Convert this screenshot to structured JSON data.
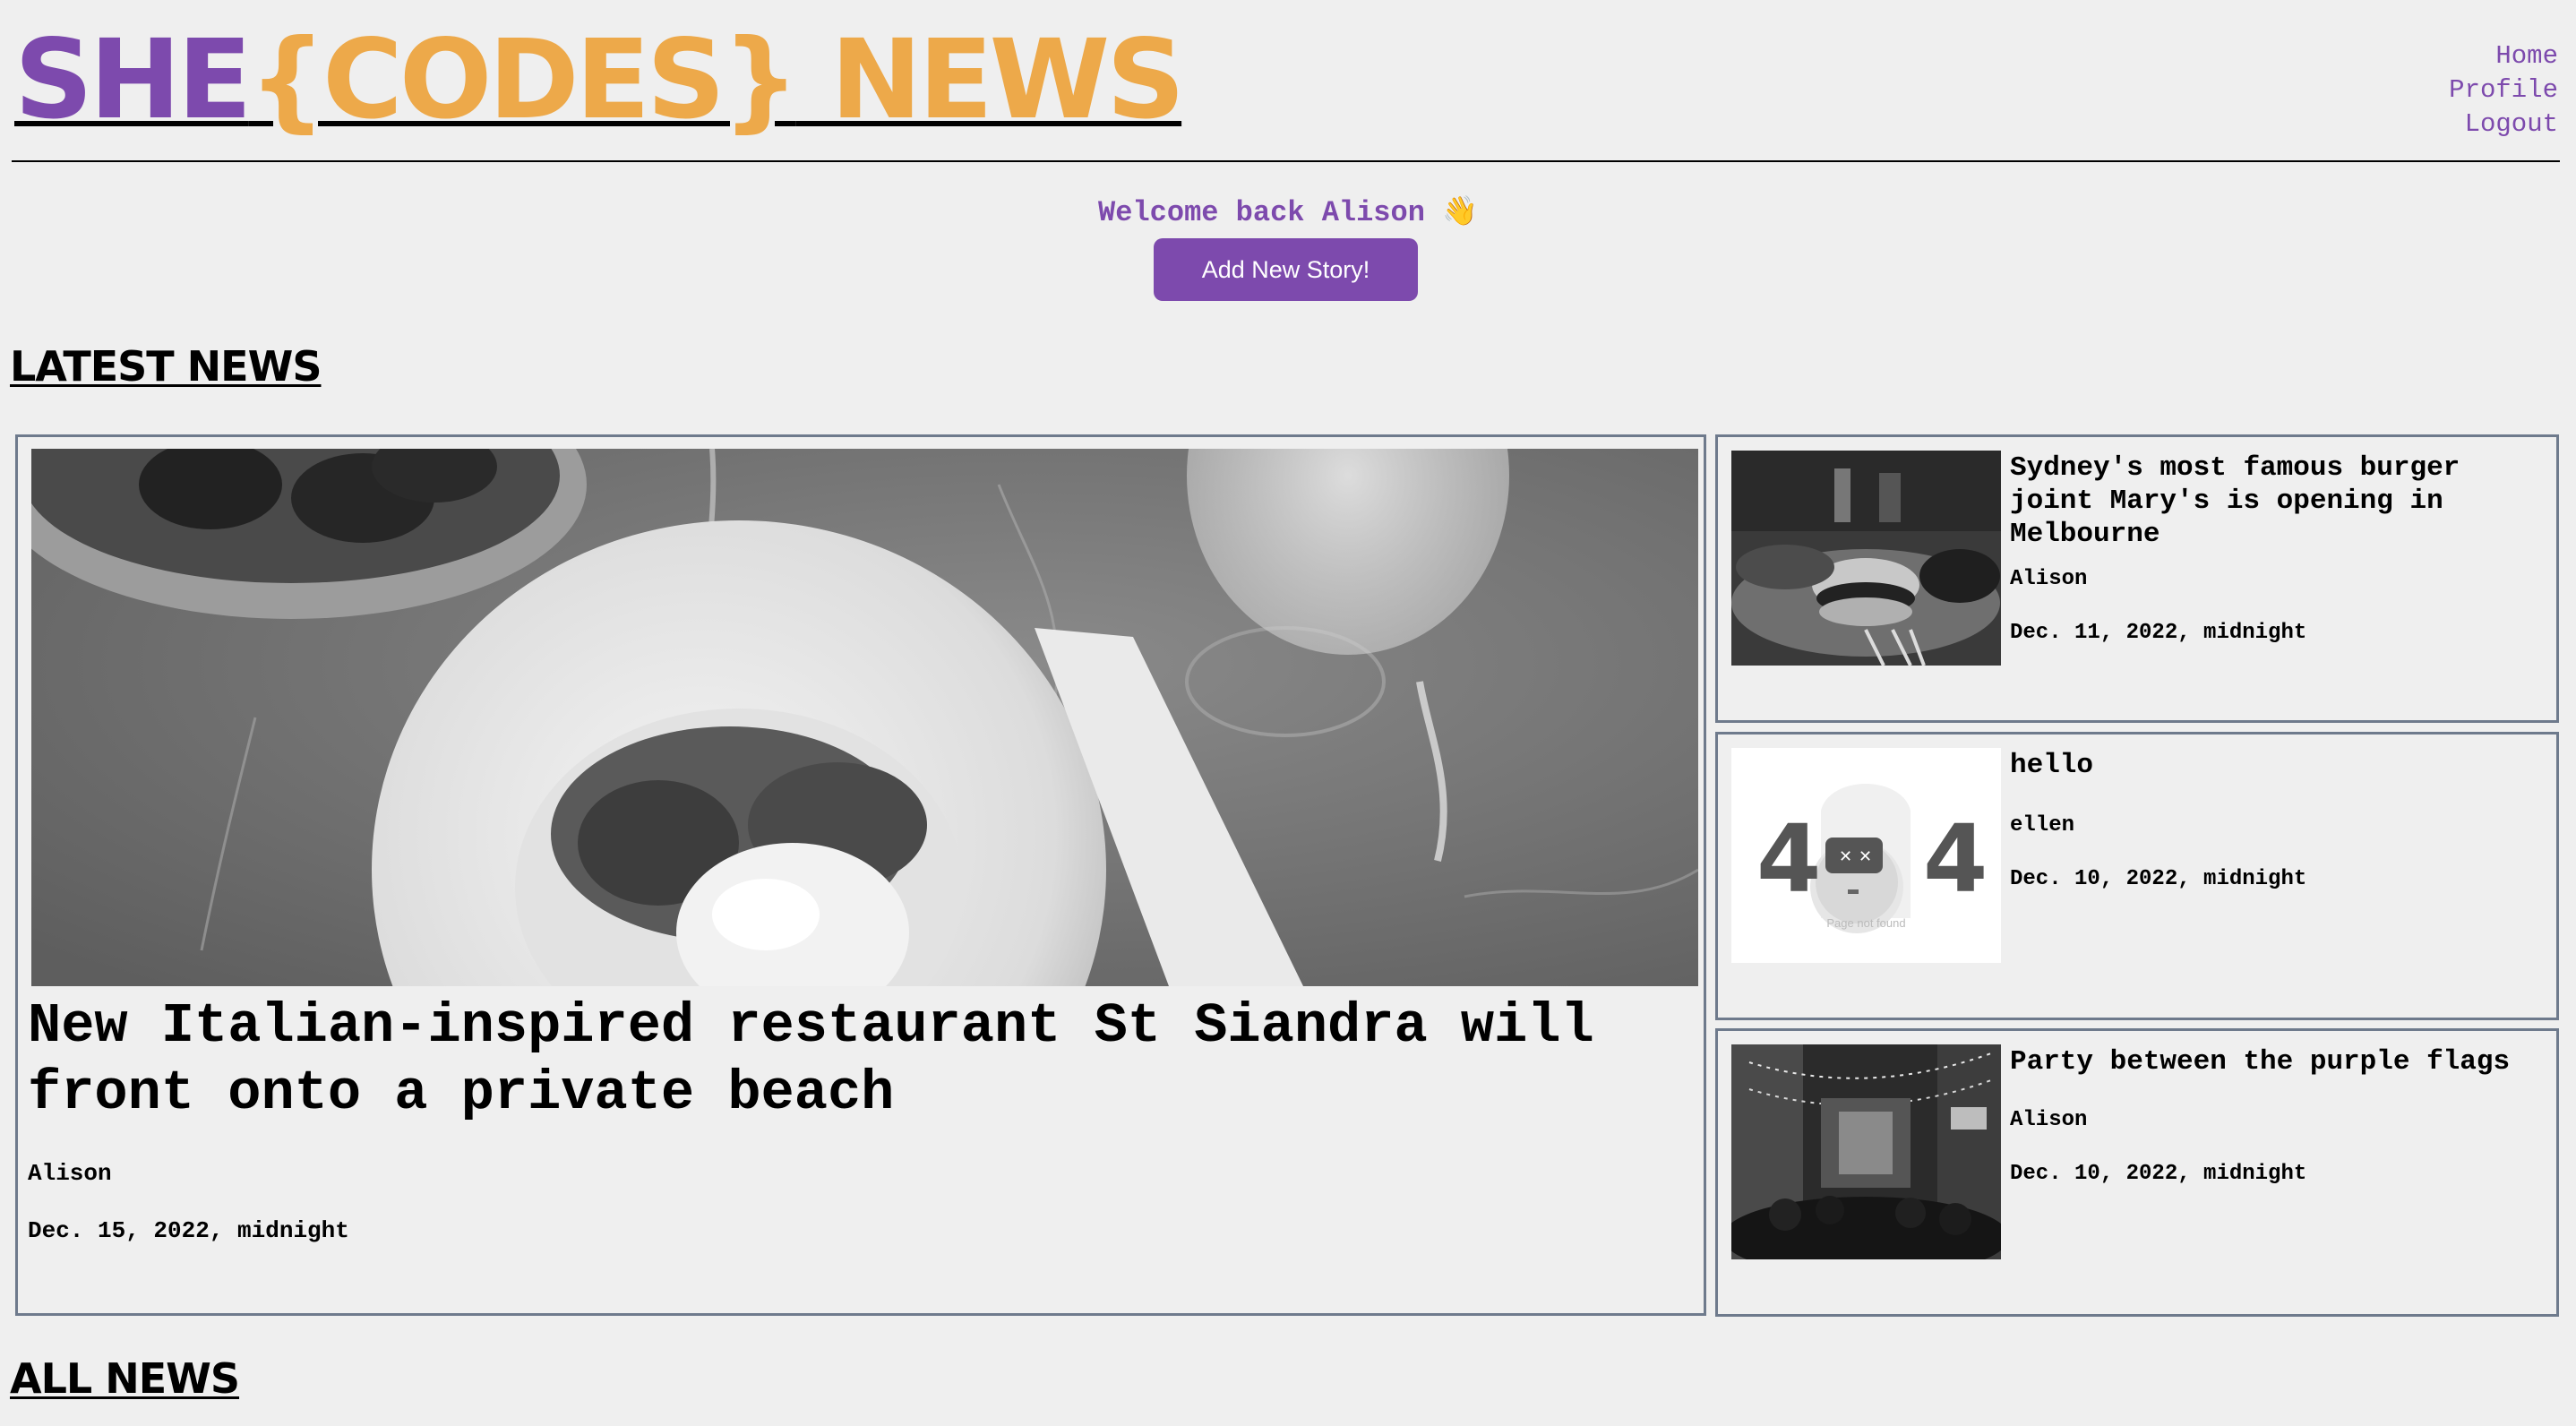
{
  "header": {
    "logo_she": "SHE",
    "logo_codes": "{CODES}",
    "logo_news": " NEWS",
    "nav": [
      "Home",
      "Profile",
      "Logout"
    ]
  },
  "welcome": {
    "text": "Welcome back Alison 👋",
    "add_button": "Add New Story!"
  },
  "sections": {
    "latest": "LATEST NEWS",
    "all": "ALL NEWS"
  },
  "featured": {
    "title": "New Italian-inspired restaurant St Siandra will front onto a private beach",
    "author": "Alison",
    "date": "Dec. 15, 2022, midnight"
  },
  "stories": [
    {
      "title": "Sydney's most famous burger joint Mary's is opening in Melbourne",
      "author": "Alison",
      "date": "Dec. 11, 2022, midnight"
    },
    {
      "title": "hello",
      "author": "ellen",
      "date": "Dec. 10, 2022, midnight",
      "image_text": "Page not found",
      "image_left_digit": "4",
      "image_right_digit": "4"
    },
    {
      "title": "Party between the purple flags",
      "author": "Alison",
      "date": "Dec. 10, 2022, midnight"
    }
  ],
  "colors": {
    "brand_purple": "#7d4aad",
    "brand_orange": "#eda94a",
    "background": "#efefef",
    "card_border": "#6e7a8c"
  }
}
